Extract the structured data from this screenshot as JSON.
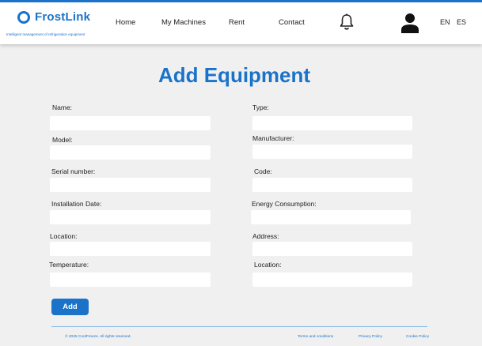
{
  "brand": {
    "name": "FrostLink",
    "tagline": "Intelligent management of refrigeration equipment"
  },
  "nav": {
    "home": "Home",
    "machines": "My Machines",
    "rent": "Rent",
    "contact": "Contact"
  },
  "languages": {
    "en": "EN",
    "es": "ES"
  },
  "page": {
    "title": "Add Equipment"
  },
  "form": {
    "name": "Name:",
    "type": "Type:",
    "model": "Model:",
    "manufacturer": "Manufacturer:",
    "serial_number": "Serial number:",
    "code": "Code:",
    "installation_date": "Installation Date:",
    "energy_consumption": "Energy Consumption:",
    "location": "Location:",
    "address": "Address:",
    "temperature": "Temperature:",
    "location_2": "Location:",
    "submit_label": "Add"
  },
  "footer": {
    "copyright": "© 2025 CoolFreeze. All rights reserved.",
    "terms": "Terms and conditions",
    "privacy": "Privacy Policy",
    "cookie": "Cookie Policy"
  },
  "colors": {
    "accent": "#1a73c9",
    "background": "#f0f0f0",
    "input": "#ffffff"
  }
}
